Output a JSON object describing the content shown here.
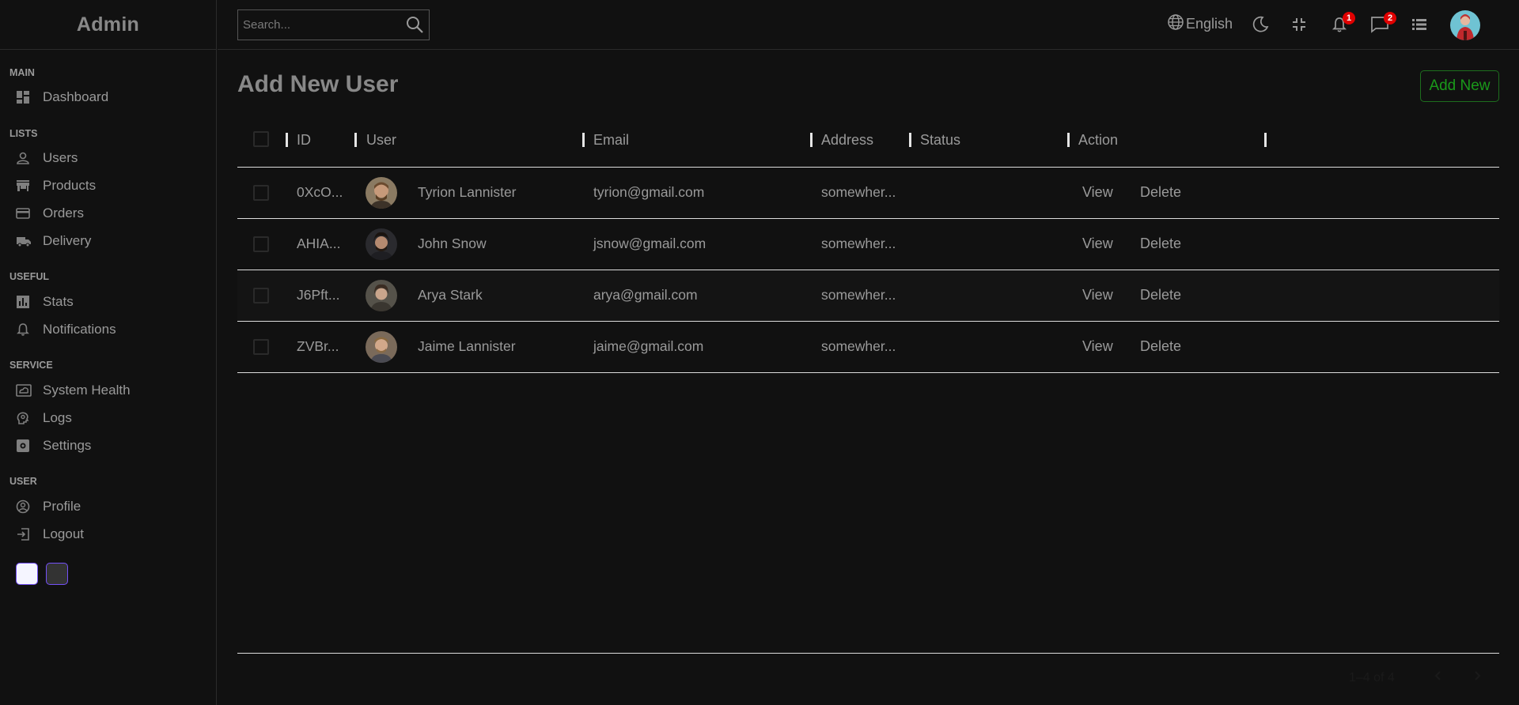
{
  "app": {
    "logo": "Admin"
  },
  "sidebar": {
    "sections": [
      {
        "title": "MAIN",
        "items": [
          {
            "label": "Dashboard",
            "icon": "dashboard-icon"
          }
        ]
      },
      {
        "title": "LISTS",
        "items": [
          {
            "label": "Users",
            "icon": "user-icon"
          },
          {
            "label": "Products",
            "icon": "store-icon"
          },
          {
            "label": "Orders",
            "icon": "credit-card-icon"
          },
          {
            "label": "Delivery",
            "icon": "truck-icon"
          }
        ]
      },
      {
        "title": "USEFUL",
        "items": [
          {
            "label": "Stats",
            "icon": "chart-icon"
          },
          {
            "label": "Notifications",
            "icon": "bell-icon"
          }
        ]
      },
      {
        "title": "SERVICE",
        "items": [
          {
            "label": "System Health",
            "icon": "health-icon"
          },
          {
            "label": "Logs",
            "icon": "psychology-icon"
          },
          {
            "label": "Settings",
            "icon": "settings-icon"
          }
        ]
      },
      {
        "title": "USER",
        "items": [
          {
            "label": "Profile",
            "icon": "account-circle-icon"
          },
          {
            "label": "Logout",
            "icon": "logout-icon"
          }
        ]
      }
    ],
    "theme_swatches": [
      {
        "name": "light",
        "color": "#f5f5ff"
      },
      {
        "name": "dark",
        "color": "#333333"
      }
    ]
  },
  "topbar": {
    "search_placeholder": "Search...",
    "language": "English",
    "notifications_count": "1",
    "messages_count": "2"
  },
  "page": {
    "title": "Add New User",
    "add_button": "Add New"
  },
  "table": {
    "columns": [
      "ID",
      "User",
      "Email",
      "Address",
      "Status",
      "Action"
    ],
    "rows": [
      {
        "id": "0XcO...",
        "user": "Tyrion Lannister",
        "email": "tyrion@gmail.com",
        "address": "somewher...",
        "status": "",
        "view": "View",
        "delete": "Delete"
      },
      {
        "id": "AHIA...",
        "user": "John Snow",
        "email": "jsnow@gmail.com",
        "address": "somewher...",
        "status": "",
        "view": "View",
        "delete": "Delete"
      },
      {
        "id": "J6Pft...",
        "user": "Arya Stark",
        "email": "arya@gmail.com",
        "address": "somewher...",
        "status": "",
        "view": "View",
        "delete": "Delete"
      },
      {
        "id": "ZVBr...",
        "user": "Jaime Lannister",
        "email": "jaime@gmail.com",
        "address": "somewher...",
        "status": "",
        "view": "View",
        "delete": "Delete"
      }
    ],
    "pagination": "1–4 of 4"
  },
  "colors": {
    "background": "#111111",
    "text": "#999999",
    "accent_green": "#1a9a1a",
    "badge_red": "#e00000",
    "swatch_border": "#7451f8"
  }
}
